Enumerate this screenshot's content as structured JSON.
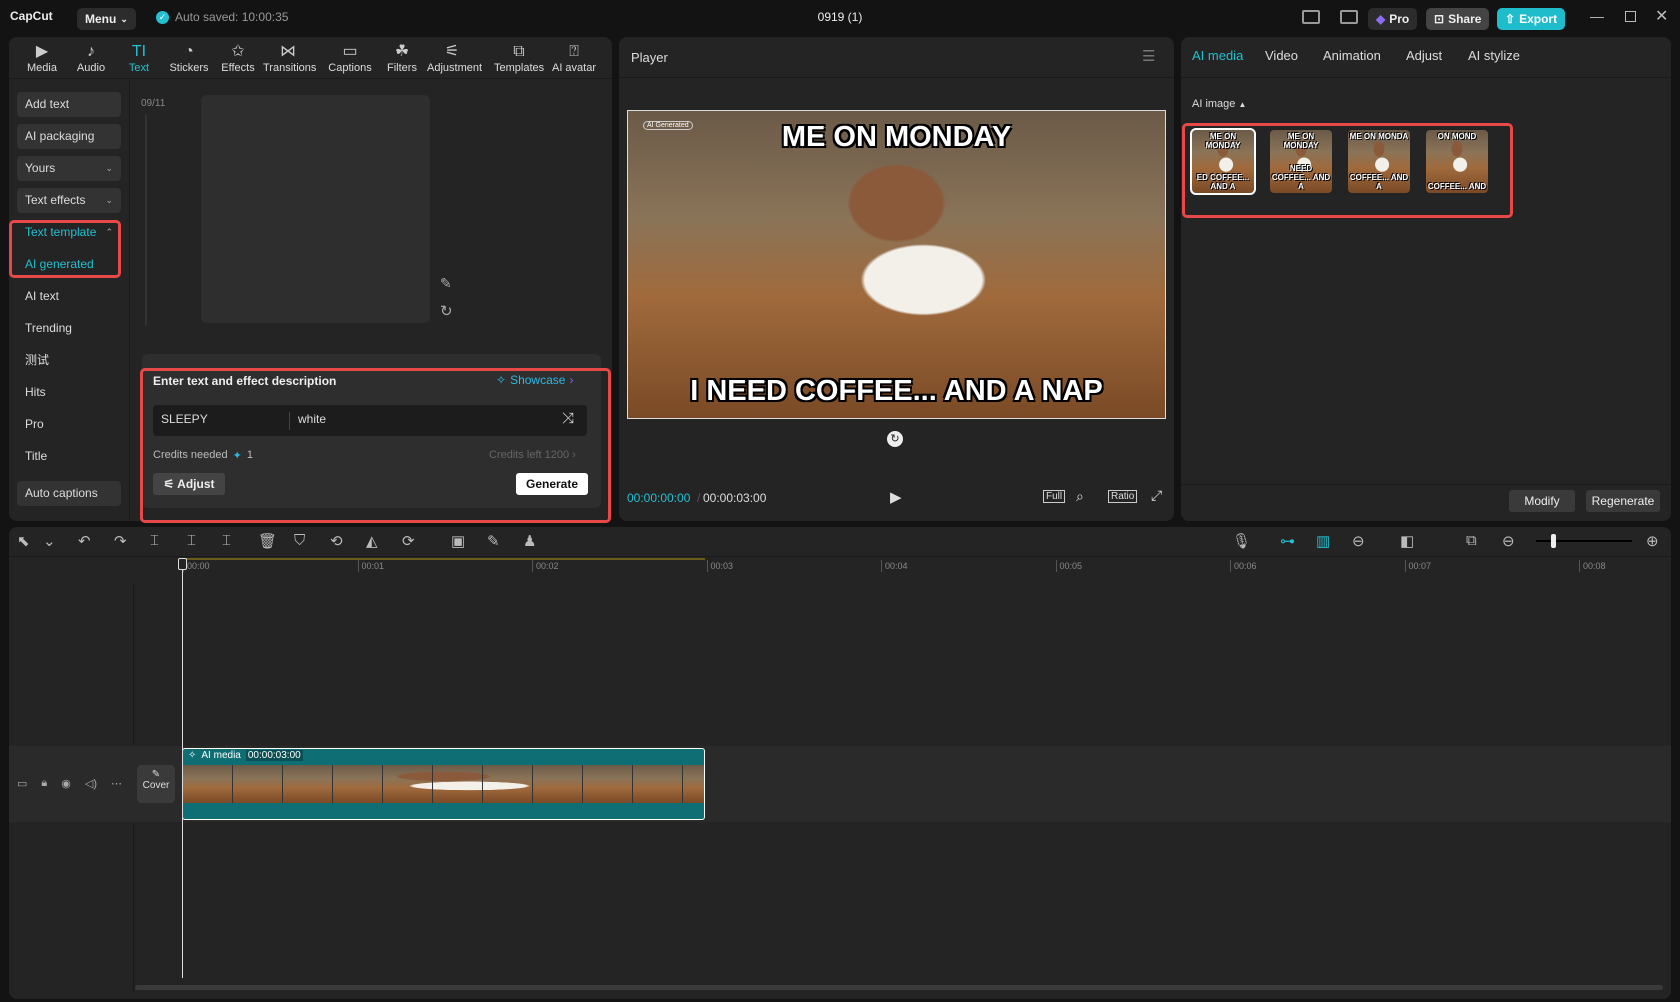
{
  "app": {
    "logo": "CapCut",
    "menu": "Menu",
    "autosave": "Auto saved: 10:00:35",
    "project_title": "0919 (1)",
    "pro": "Pro",
    "share": "Share",
    "export": "Export"
  },
  "toolbar": [
    {
      "label": "Media",
      "icon": "▶"
    },
    {
      "label": "Audio",
      "icon": "♪"
    },
    {
      "label": "Text",
      "icon": "TI"
    },
    {
      "label": "Stickers",
      "icon": "◔"
    },
    {
      "label": "Effects",
      "icon": "✩"
    },
    {
      "label": "Transitions",
      "icon": "⋈"
    },
    {
      "label": "Captions",
      "icon": "▭"
    },
    {
      "label": "Filters",
      "icon": "☘"
    },
    {
      "label": "Adjustment",
      "icon": "⚟"
    },
    {
      "label": "Templates",
      "icon": "⧉"
    },
    {
      "label": "AI avatar",
      "icon": "⍰"
    }
  ],
  "sidebar": [
    {
      "label": "Add text"
    },
    {
      "label": "AI packaging"
    },
    {
      "label": "Yours",
      "chevron": "⌄"
    },
    {
      "label": "Text effects",
      "chevron": "⌄"
    },
    {
      "label": "Text template",
      "chevron": "⌃"
    },
    {
      "label": "AI generated"
    },
    {
      "label": "AI text"
    },
    {
      "label": "Trending"
    },
    {
      "label": "测试"
    },
    {
      "label": "Hits"
    },
    {
      "label": "Pro"
    },
    {
      "label": "Title"
    },
    {
      "label": "Auto captions"
    }
  ],
  "library": {
    "counter": "09/11"
  },
  "generator": {
    "title": "Enter text and effect description",
    "showcase": "Showcase",
    "text_value": "SLEEPY",
    "effect_value": "white",
    "credits_needed_label": "Credits needed",
    "credits_needed": "1",
    "credits_left": "Credits left 1200",
    "adjust": "Adjust",
    "generate": "Generate"
  },
  "player": {
    "title": "Player",
    "top_text": "ME ON MONDAY",
    "bottom_text": "I NEED COFFEE... AND A NAP",
    "watermark": "AI Generated",
    "current_time": "00:00:00:00",
    "total_time": "00:00:03:00",
    "full": "Full",
    "ratio": "Ratio"
  },
  "right": {
    "tabs": [
      "AI media",
      "Video",
      "Animation",
      "Adjust",
      "AI stylize"
    ],
    "section": "AI image",
    "thumbs": [
      {
        "top": "ME ON MONDAY",
        "bottom": "ED COFFEE... AND A"
      },
      {
        "top": "ME ON MONDAY",
        "bottom": "NEED COFFEE... AND A"
      },
      {
        "top": "ME ON MONDA",
        "bottom": "COFFEE... AND A"
      },
      {
        "top": "ON MOND",
        "bottom": "COFFEE... AND"
      }
    ],
    "modify": "Modify",
    "regenerate": "Regenerate"
  },
  "timeline": {
    "ruler": [
      "00:00",
      "00:01",
      "00:02",
      "00:03",
      "00:04",
      "00:05",
      "00:06",
      "00:07",
      "00:08"
    ],
    "clip_label": "AI media",
    "clip_duration": "00:00:03:00",
    "cover": "Cover"
  },
  "colors": {
    "accent": "#22c0d0",
    "highlight": "#e84848",
    "clip": "#0f6e73"
  }
}
